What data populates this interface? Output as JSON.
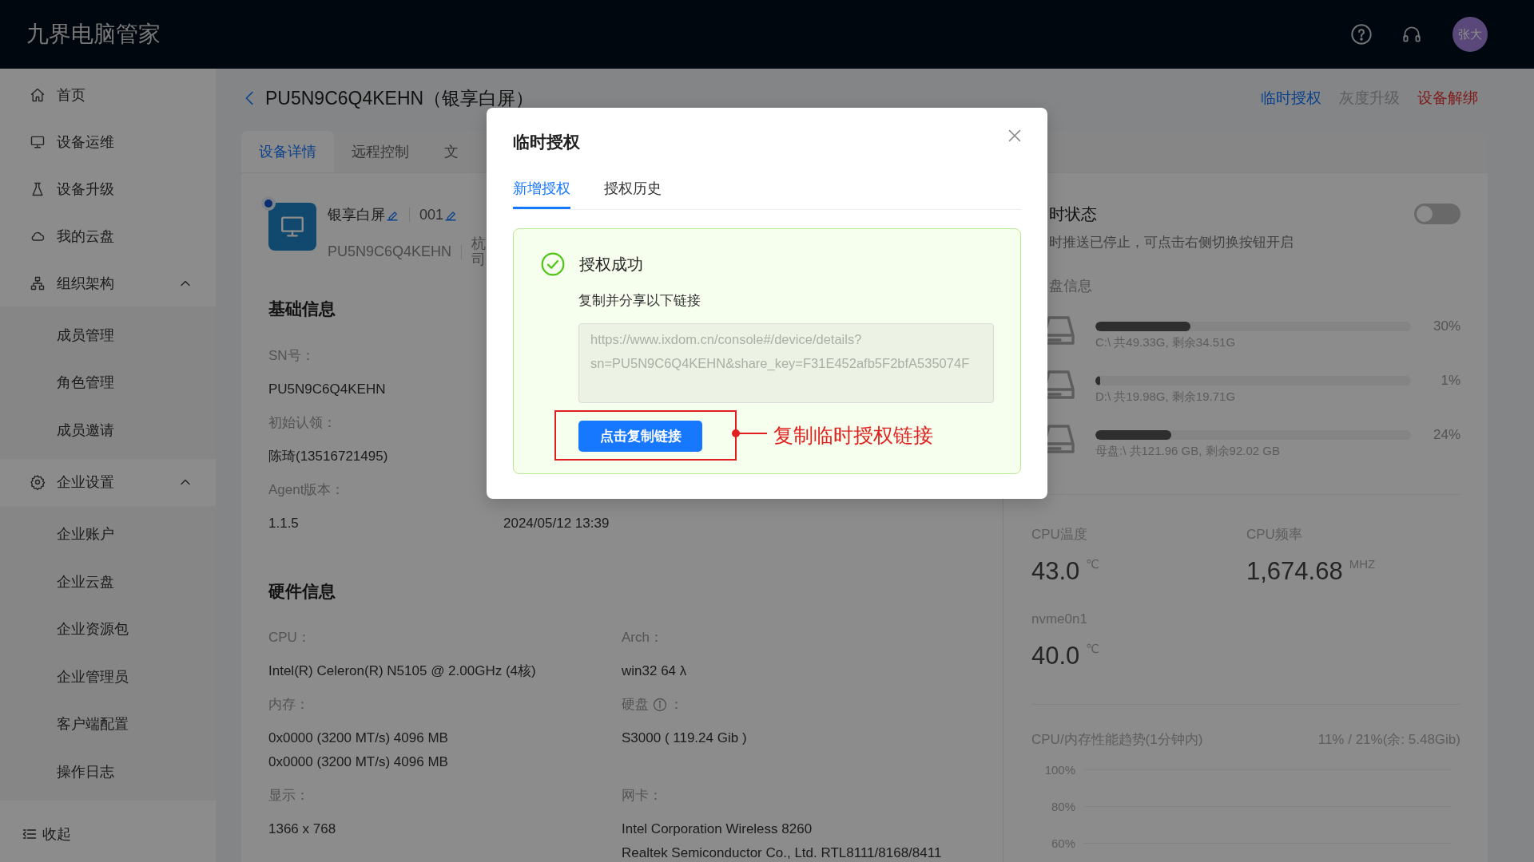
{
  "header": {
    "app_name": "九界电脑管家",
    "avatar_text": "张大"
  },
  "sidebar": {
    "items": [
      {
        "label": "首页",
        "kind": "home"
      },
      {
        "label": "设备运维",
        "kind": "monitor"
      },
      {
        "label": "设备升级",
        "kind": "flask"
      },
      {
        "label": "我的云盘",
        "kind": "cloud"
      },
      {
        "label": "组织架构",
        "kind": "sitemap",
        "expanded": true,
        "children": [
          {
            "label": "成员管理"
          },
          {
            "label": "角色管理"
          },
          {
            "label": "成员邀请"
          }
        ]
      },
      {
        "label": "企业设置",
        "kind": "gear",
        "expanded": true,
        "children": [
          {
            "label": "企业账户"
          },
          {
            "label": "企业云盘"
          },
          {
            "label": "企业资源包"
          },
          {
            "label": "企业管理员"
          },
          {
            "label": "客户端配置"
          },
          {
            "label": "操作日志"
          }
        ]
      }
    ],
    "collapse_label": "收起"
  },
  "page": {
    "title": "PU5N9C6Q4KEHN（银享白屏）",
    "actions": [
      {
        "label": "临时授权",
        "kind": "primary"
      },
      {
        "label": "灰度升级",
        "kind": "disabled"
      },
      {
        "label": "设备解绑",
        "kind": "danger"
      }
    ]
  },
  "device_card": {
    "tabs": [
      {
        "label": "设备详情",
        "selected": true
      },
      {
        "label": "远程控制",
        "selected": false
      },
      {
        "label": "文",
        "selected": false
      }
    ],
    "device": {
      "name": "银享白屏",
      "number": "001",
      "sn": "PU5N9C6Q4KEHN",
      "company": "杭司",
      "online": true
    },
    "basic_info": {
      "title": "基础信息",
      "fields": [
        {
          "label": "SN号：",
          "value": "PU5N9C6Q4KEHN"
        },
        {
          "label": "初始认领：",
          "value": "陈琦(13516721495)"
        },
        {
          "label": "Agent版本：",
          "value": "1.1.5"
        }
      ],
      "extra_value": "2024/05/12 13:39"
    },
    "hardware_info": {
      "title": "硬件信息",
      "fields": [
        {
          "label": "CPU：",
          "values": [
            "Intel(R) Celeron(R) N5105 @ 2.00GHz (4核)"
          ]
        },
        {
          "label": "Arch：",
          "values": [
            "win32 64 λ"
          ]
        },
        {
          "label": "内存：",
          "values": [
            "0x0000 (3200 MT/s) 4096 MB",
            "0x0000 (3200 MT/s) 4096 MB"
          ]
        },
        {
          "label": "硬盘",
          "info": true,
          "label_suffix": "：",
          "values": [
            "S3000 ( 119.24 Gib )"
          ]
        },
        {
          "label": "显示：",
          "values": [
            "1366 x 768"
          ]
        },
        {
          "label": "网卡：",
          "values": [
            "Intel Corporation Wireless 8260",
            "Realtek Semiconductor Co., Ltd. RTL8111/8168/8411"
          ]
        }
      ]
    }
  },
  "right_panel": {
    "realtime": {
      "title": "时状态",
      "note": "时推送已停止，可点击右侧切换按钮开启",
      "on": false
    },
    "disk_title": "盘信息",
    "disks": [
      {
        "level": 0.3,
        "percent": "30%",
        "caption": "C:\\ 共49.33G, 剩余34.51G"
      },
      {
        "level": 0.01,
        "percent": "1%",
        "caption": "D:\\ 共19.98G, 剩余19.71G"
      },
      {
        "level": 0.24,
        "percent": "24%",
        "caption": "母盘:\\ 共121.96 GB, 剩余92.02 GB"
      }
    ],
    "sensors": [
      {
        "label": "CPU温度",
        "value": "43.0",
        "unit": "℃"
      },
      {
        "label": "CPU频率",
        "value": "1,674.68",
        "unit": "MHZ"
      },
      {
        "label": "nvme0n1",
        "value": "40.0",
        "unit": "℃"
      }
    ],
    "trend": {
      "title": "CPU/内存性能趋势(1分钟内)",
      "summary": "11% / 21%(余: 5.48Gib)",
      "y_tick_labels": [
        "100%",
        "80%",
        "60%"
      ]
    }
  },
  "modal": {
    "title": "临时授权",
    "tabs": [
      {
        "label": "新增授权",
        "selected": true
      },
      {
        "label": "授权历史",
        "selected": false
      }
    ],
    "result": {
      "title": "授权成功",
      "hint": "复制并分享以下链接",
      "link": "https://www.ixdom.cn/console#/device/details?sn=PU5N9C6Q4KEHN&share_key=F31E452afb5F2bfA535074F",
      "button": "点击复制链接"
    },
    "annotation": "复制临时授权链接"
  }
}
